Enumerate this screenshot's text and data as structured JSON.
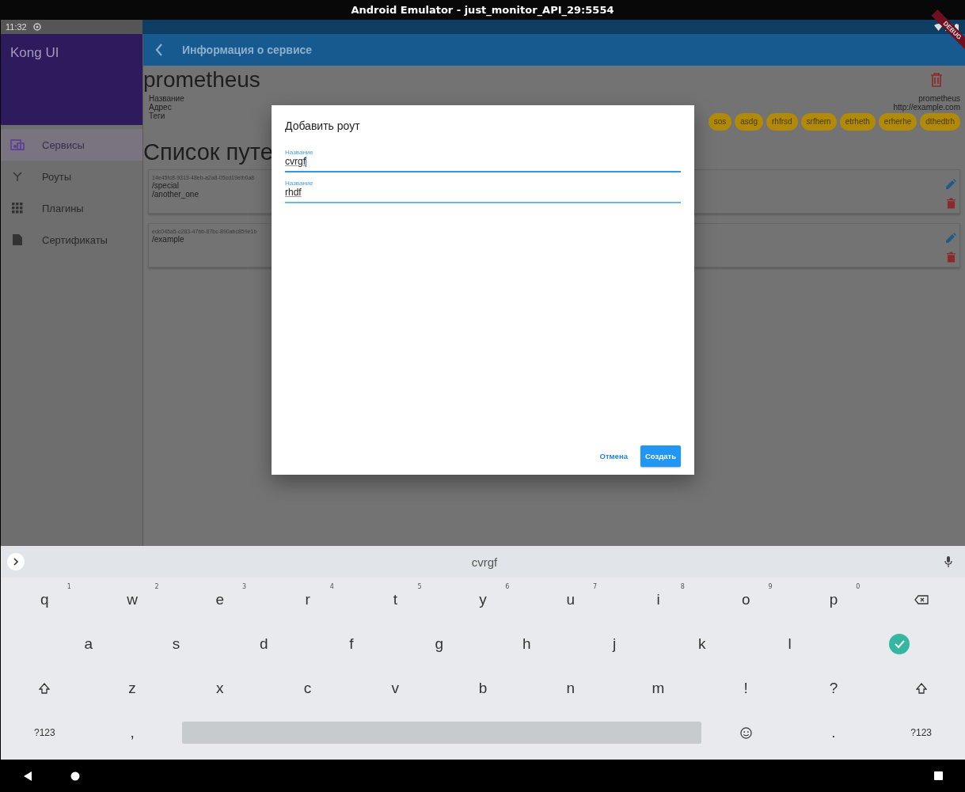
{
  "window": {
    "title": "Android Emulator - just_monitor_API_29:5554"
  },
  "status_bar": {
    "time": "11:32"
  },
  "debug_banner": "DEBUG",
  "drawer": {
    "title": "Kong UI",
    "items": [
      {
        "label": "Сервисы",
        "selected": true
      },
      {
        "label": "Роуты",
        "selected": false
      },
      {
        "label": "Плагины",
        "selected": false
      },
      {
        "label": "Сертификаты",
        "selected": false
      }
    ]
  },
  "app_bar": {
    "title": "Информация о сервисе"
  },
  "service": {
    "name": "prometheus",
    "fields": [
      {
        "label": "Название",
        "value": "prometheus"
      },
      {
        "label": "Адрес",
        "value": "http://example.com"
      },
      {
        "label": "Теги"
      }
    ],
    "tags": [
      "sos",
      "asdg",
      "rhfrsd",
      "srfhern",
      "etrheth",
      "erherhe",
      "dthedtrh"
    ]
  },
  "routes_heading": "Список путе",
  "routes": [
    {
      "id": "14e45fc8-9313-48eb-a2a8-05cd19etb0a8",
      "paths": [
        "/special",
        "/another_one"
      ]
    },
    {
      "id": "edc045a5-c283-47bb-87bc-890abc859e1b",
      "paths": [
        "/example"
      ]
    }
  ],
  "dialog": {
    "title": "Добавить роут",
    "fields": [
      {
        "label": "Название",
        "value": "cvrgf",
        "focused": true
      },
      {
        "label": "Название",
        "value": "rhdf",
        "focused": false
      }
    ],
    "buttons": [
      {
        "label": "Отмена",
        "kind": "text"
      },
      {
        "label": "Создать",
        "kind": "filled"
      }
    ]
  },
  "keyboard": {
    "suggestion": "cvrgf",
    "rows": [
      [
        {
          "kind": "char",
          "label": "q",
          "hint": "1"
        },
        {
          "kind": "char",
          "label": "w",
          "hint": "2"
        },
        {
          "kind": "char",
          "label": "e",
          "hint": "3"
        },
        {
          "kind": "char",
          "label": "r",
          "hint": "4"
        },
        {
          "kind": "char",
          "label": "t",
          "hint": "5"
        },
        {
          "kind": "char",
          "label": "y",
          "hint": "6"
        },
        {
          "kind": "char",
          "label": "u",
          "hint": "7"
        },
        {
          "kind": "char",
          "label": "i",
          "hint": "8"
        },
        {
          "kind": "char",
          "label": "o",
          "hint": "9"
        },
        {
          "kind": "char",
          "label": "p",
          "hint": "0"
        },
        {
          "kind": "backspace"
        }
      ],
      [
        {
          "kind": "gap"
        },
        {
          "kind": "char",
          "label": "a"
        },
        {
          "kind": "char",
          "label": "s"
        },
        {
          "kind": "char",
          "label": "d"
        },
        {
          "kind": "char",
          "label": "f"
        },
        {
          "kind": "char",
          "label": "g"
        },
        {
          "kind": "char",
          "label": "h"
        },
        {
          "kind": "char",
          "label": "j"
        },
        {
          "kind": "char",
          "label": "k"
        },
        {
          "kind": "char",
          "label": "l"
        },
        {
          "kind": "done"
        }
      ],
      [
        {
          "kind": "shift"
        },
        {
          "kind": "char",
          "label": "z"
        },
        {
          "kind": "char",
          "label": "x"
        },
        {
          "kind": "char",
          "label": "c"
        },
        {
          "kind": "char",
          "label": "v"
        },
        {
          "kind": "char",
          "label": "b"
        },
        {
          "kind": "char",
          "label": "n"
        },
        {
          "kind": "char",
          "label": "m"
        },
        {
          "kind": "char",
          "label": "!"
        },
        {
          "kind": "char",
          "label": "?"
        },
        {
          "kind": "shift"
        }
      ]
    ],
    "bottom_row": {
      "left_keys": [
        {
          "kind": "mode",
          "label": "?123"
        },
        {
          "kind": "char",
          "label": ","
        }
      ],
      "right_keys": [
        {
          "kind": "emoji"
        },
        {
          "kind": "char",
          "label": "."
        },
        {
          "kind": "mode",
          "label": "?123"
        }
      ]
    }
  }
}
